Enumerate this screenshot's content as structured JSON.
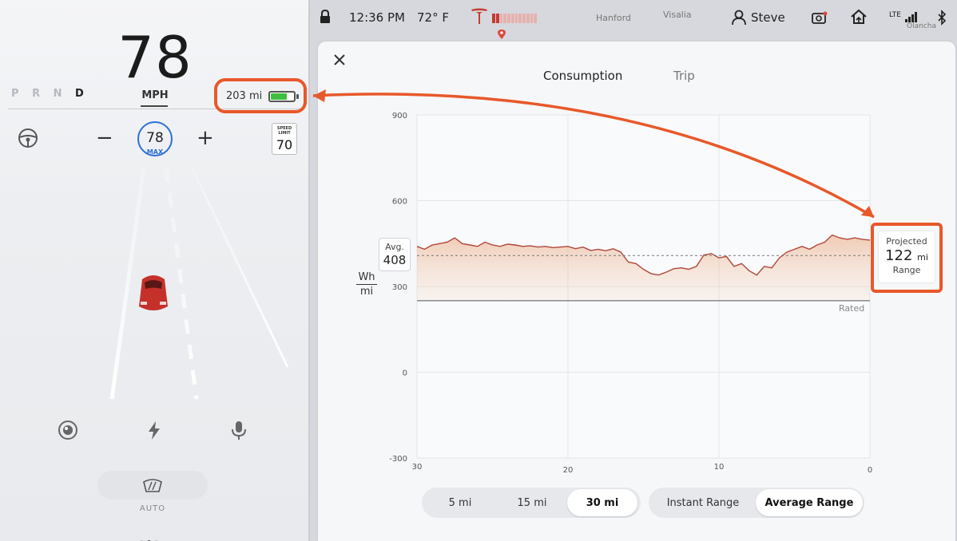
{
  "drive": {
    "speed": "78",
    "speed_unit": "MPH",
    "gears": [
      "P",
      "R",
      "N",
      "D"
    ],
    "active_gear": "D",
    "range": "203 mi",
    "battery_level": 0.72,
    "set_speed": "78",
    "set_speed_label": "MAX",
    "speed_limit_label": "SPEED LIMIT",
    "speed_limit": "70",
    "minus_label": "−",
    "plus_label": "+",
    "wiper_label": "AUTO",
    "page_dots": 3,
    "active_dot": 1
  },
  "status_bar": {
    "time": "12:36 PM",
    "temperature": "72° F",
    "user": "Steve",
    "network": "LTE",
    "map_labels": [
      "Hanford",
      "Visalia",
      "Olancha"
    ],
    "charge_segments": 12,
    "charge_filled": 2
  },
  "energy": {
    "tabs": [
      {
        "label": "Consumption",
        "active": true
      },
      {
        "label": "Trip",
        "active": false
      }
    ],
    "avg_label": "Avg.",
    "avg_value": "408",
    "unit_numerator": "Wh",
    "unit_denominator": "mi",
    "rated_label": "Rated",
    "projected": {
      "top": "Projected",
      "value": "122",
      "unit": "mi",
      "bottom": "Range"
    },
    "distance_options": [
      {
        "label": "5 mi",
        "selected": false
      },
      {
        "label": "15 mi",
        "selected": false
      },
      {
        "label": "30 mi",
        "selected": true
      }
    ],
    "range_options": [
      {
        "label": "Instant Range",
        "selected": false
      },
      {
        "label": "Average Range",
        "selected": true
      }
    ]
  },
  "chart_data": {
    "type": "area",
    "title": "",
    "xlabel": "",
    "ylabel": "Wh/mi",
    "x_ticks": [
      "30",
      "20",
      "10",
      "0"
    ],
    "xlim": [
      30,
      0
    ],
    "y_ticks": [
      "900",
      "600",
      "300",
      "0",
      "-300"
    ],
    "ylim": [
      -300,
      900
    ],
    "grid": true,
    "avg": 408,
    "rated": 250,
    "series": [
      {
        "x": [
          30,
          29.5,
          29,
          28.5,
          28,
          27.5,
          27,
          26.5,
          26,
          25.5,
          25,
          24.5,
          24,
          23.5,
          23,
          22.5,
          22,
          21.5,
          21,
          20.5,
          20,
          19.5,
          19,
          18.5,
          18,
          17.5,
          17,
          16.5,
          16,
          15.5,
          15,
          14.5,
          14,
          13.5,
          13,
          12.5,
          12,
          11.5,
          11,
          10.5,
          10,
          9.5,
          9,
          8.5,
          8,
          7.5,
          7,
          6.5,
          6,
          5.5,
          5,
          4.5,
          4,
          3.5,
          3,
          2.5,
          2,
          1.5,
          1,
          0.5,
          0
        ],
        "y": [
          440,
          430,
          445,
          450,
          455,
          470,
          450,
          445,
          440,
          455,
          445,
          440,
          448,
          445,
          440,
          442,
          438,
          440,
          436,
          438,
          440,
          432,
          438,
          426,
          430,
          425,
          432,
          420,
          385,
          380,
          360,
          345,
          340,
          350,
          362,
          365,
          360,
          370,
          410,
          415,
          400,
          405,
          370,
          380,
          355,
          340,
          370,
          365,
          400,
          420,
          430,
          440,
          430,
          445,
          455,
          480,
          470,
          465,
          470,
          465,
          462
        ]
      }
    ]
  }
}
